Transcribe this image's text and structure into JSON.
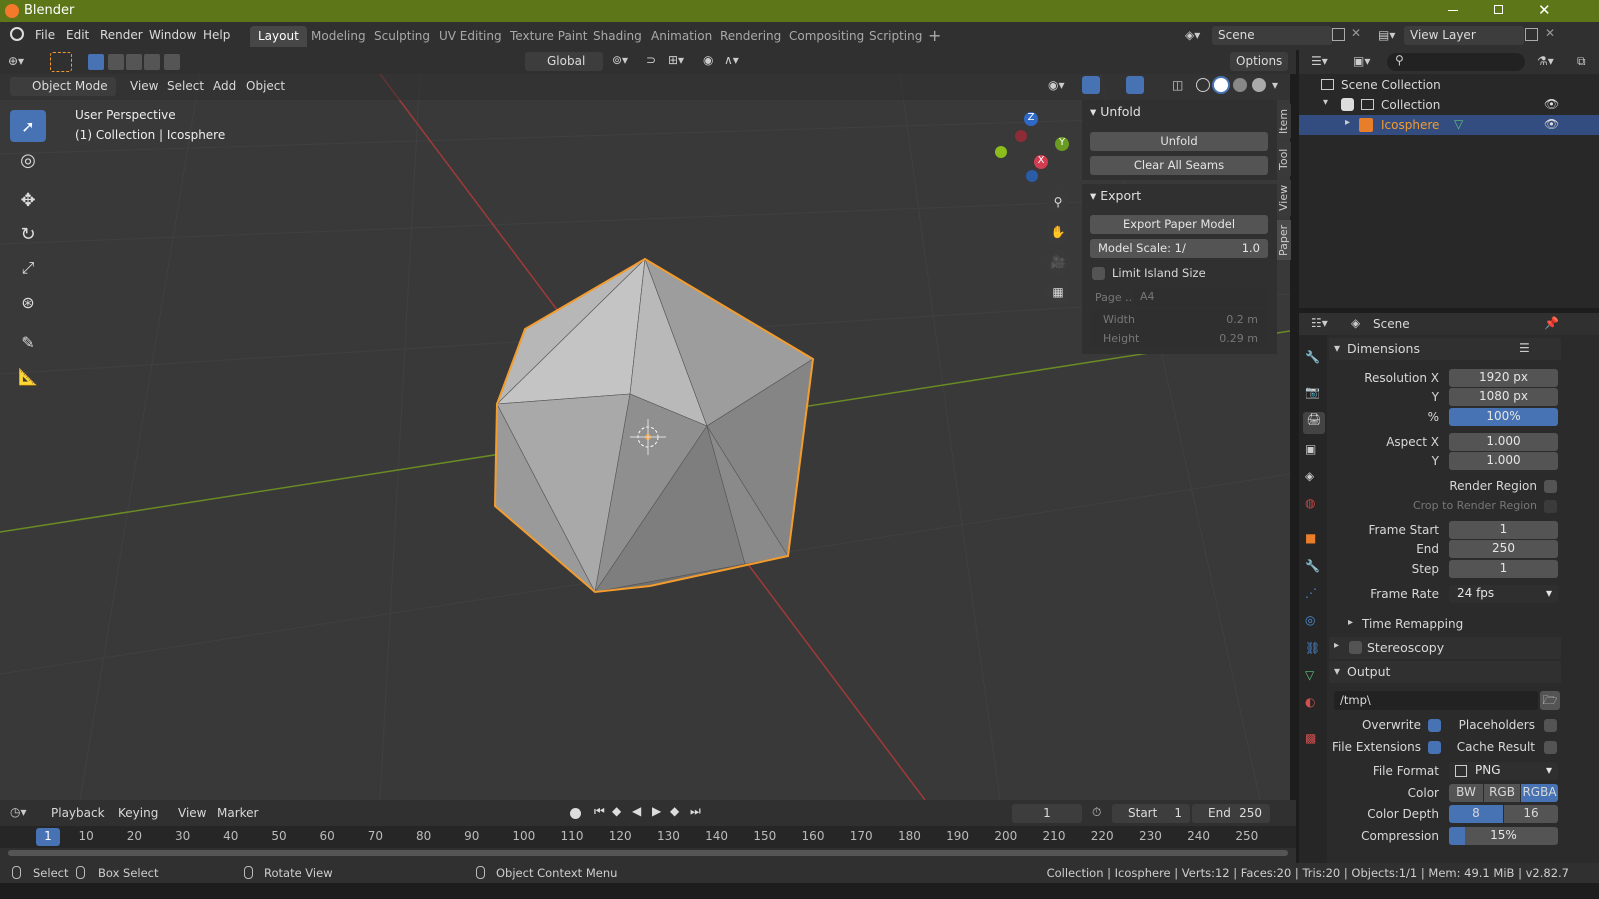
{
  "window": {
    "title": "Blender"
  },
  "menu": [
    "File",
    "Edit",
    "Render",
    "Window",
    "Help"
  ],
  "workspaces": [
    "Layout",
    "Modeling",
    "Sculpting",
    "UV Editing",
    "Texture Paint",
    "Shading",
    "Animation",
    "Rendering",
    "Compositing",
    "Scripting"
  ],
  "scene_field": "Scene",
  "view_layer_field": "View Layer",
  "toolbar": {
    "transform_orientation": "Global",
    "options_label": "Options"
  },
  "viewport": {
    "mode": "Object Mode",
    "menus": [
      "View",
      "Select",
      "Add",
      "Object"
    ],
    "overlay_title": "User Perspective",
    "overlay_sub": "(1) Collection | Icosphere",
    "gizmo": {
      "z": "Z",
      "y": "Y",
      "x": "X"
    }
  },
  "npanel": {
    "unfold_header": "Unfold",
    "unfold_btn": "Unfold",
    "clear_btn": "Clear All Seams",
    "export_header": "Export",
    "export_btn": "Export Paper Model",
    "model_scale_label": "Model Scale: 1/",
    "model_scale_value": "1.0",
    "limit_label": "Limit Island Size",
    "page_label": "Page ..",
    "page_value": "A4",
    "width_label": "Width",
    "width_value": "0.2 m",
    "height_label": "Height",
    "height_value": "0.29 m",
    "tabs": [
      "Item",
      "Tool",
      "View",
      "Paper"
    ]
  },
  "outliner": {
    "scene_collection": "Scene Collection",
    "collection": "Collection",
    "object": "Icosphere"
  },
  "properties": {
    "context": "Scene",
    "dimensions_header": "Dimensions",
    "res_x_label": "Resolution X",
    "res_x": "1920 px",
    "res_y_label": "Y",
    "res_y": "1080 px",
    "pct_label": "%",
    "pct": "100%",
    "aspect_x_label": "Aspect X",
    "aspect_x": "1.000",
    "aspect_y_label": "Y",
    "aspect_y": "1.000",
    "render_region": "Render Region",
    "crop": "Crop to Render Region",
    "frame_start_label": "Frame Start",
    "frame_start": "1",
    "end_label": "End",
    "end": "250",
    "step_label": "Step",
    "step": "1",
    "frame_rate_label": "Frame Rate",
    "frame_rate": "24 fps",
    "time_remap": "Time Remapping",
    "stereoscopy": "Stereoscopy",
    "output_header": "Output",
    "path": "/tmp\\",
    "overwrite": "Overwrite",
    "placeholders": "Placeholders",
    "file_ext": "File Extensions",
    "cache_result": "Cache Result",
    "file_format_label": "File Format",
    "file_format": "PNG",
    "color_label": "Color",
    "color_opts": [
      "BW",
      "RGB",
      "RGBA"
    ],
    "depth_label": "Color Depth",
    "depth_opts": [
      "8",
      "16"
    ],
    "compression_label": "Compression",
    "compression": "15%"
  },
  "timeline": {
    "menus": [
      "Playback",
      "Keying",
      "View",
      "Marker"
    ],
    "current": "1",
    "start_label": "Start",
    "start": "1",
    "end_label": "End",
    "end": "250",
    "ruler": [
      "1",
      "10",
      "20",
      "30",
      "40",
      "50",
      "60",
      "70",
      "80",
      "90",
      "100",
      "110",
      "120",
      "130",
      "140",
      "150",
      "160",
      "170",
      "180",
      "190",
      "200",
      "210",
      "220",
      "230",
      "240",
      "250"
    ]
  },
  "status": {
    "select": "Select",
    "box_select": "Box Select",
    "rotate": "Rotate View",
    "context_menu": "Object Context Menu",
    "info": "Collection | Icosphere | Verts:12 | Faces:20 | Tris:20 | Objects:1/1 | Mem: 49.1 MiB | v2.82.7"
  },
  "colors": {
    "title_bar": "#5d7718",
    "accent": "#4772b3",
    "selection": "#f39c2e",
    "x_axis": "#a13939",
    "y_axis": "#6a8a24"
  }
}
